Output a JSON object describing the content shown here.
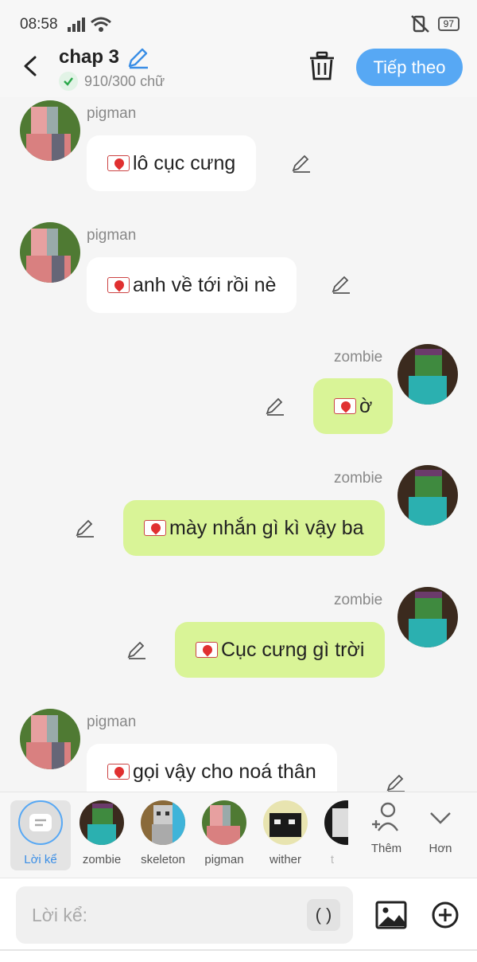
{
  "status_bar": {
    "time": "08:58",
    "battery": "97"
  },
  "header": {
    "title": "chap 3",
    "word_count": "910/300 chữ",
    "next_label": "Tiếp theo"
  },
  "messages": [
    {
      "sender": "pigman",
      "text": "lô cục cưng",
      "side": "left"
    },
    {
      "sender": "pigman",
      "text": "anh về tới rồi nè",
      "side": "left"
    },
    {
      "sender": "zombie",
      "text": "ờ",
      "side": "right"
    },
    {
      "sender": "zombie",
      "text": "mày nhắn gì kì vậy ba",
      "side": "right"
    },
    {
      "sender": "zombie",
      "text": "Cục cưng gì trời",
      "side": "right"
    },
    {
      "sender": "pigman",
      "text": "gọi vậy cho noá thân",
      "side": "left"
    }
  ],
  "characters": [
    {
      "label": "Lời kể",
      "selected": true
    },
    {
      "label": "zombie"
    },
    {
      "label": "skeleton"
    },
    {
      "label": "pigman"
    },
    {
      "label": "wither"
    },
    {
      "label": "t"
    }
  ],
  "actions": {
    "add_label": "Thêm",
    "more_label": "Hơn"
  },
  "input": {
    "placeholder": "Lời kể:",
    "paren": "( )"
  },
  "colors": {
    "accent": "#57a8f4",
    "right_bubble": "#d9f497",
    "left_bubble": "#ffffff"
  }
}
